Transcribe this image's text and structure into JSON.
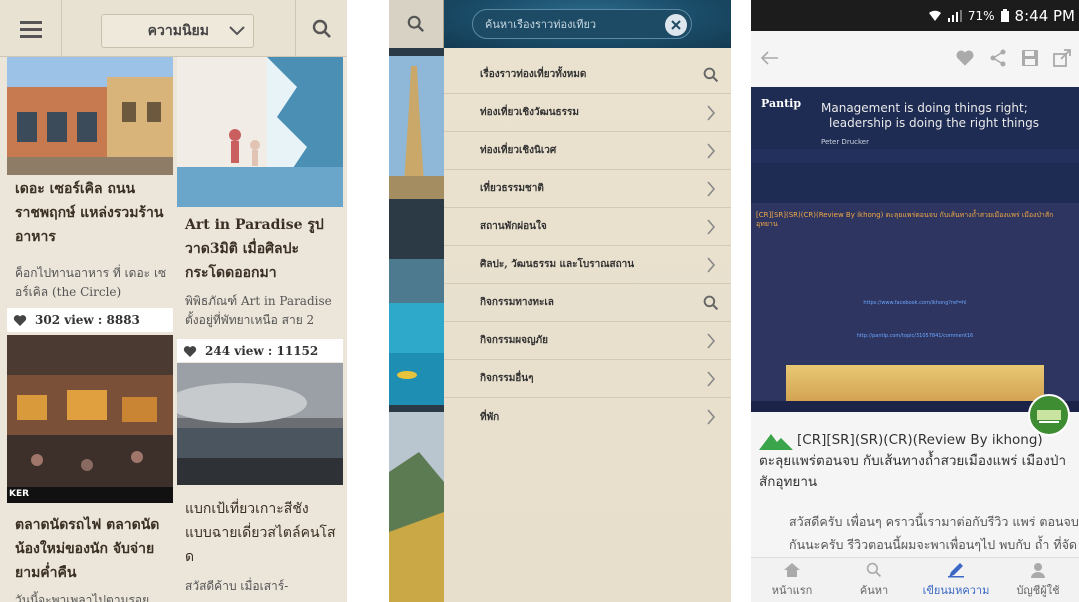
{
  "screen1": {
    "sort_label": "ความนิยม",
    "cards": [
      {
        "title": "เดอะ เซอร์เคิล ถนนราชพฤกษ์ แหล่งรวมร้านอาหาร",
        "desc": "ค็อกไปทานอาหาร ที่ เดอะ เซอร์เคิล (the Circle)",
        "stats": "302 view : 8883"
      },
      {
        "title": "Art in Paradise รูปวาด3มิติ เมื่อศิลปะกระโดดออกมา",
        "desc": "พิพิธภัณฑ์ Art in Paradise ตั้งอยู่ที่พัทยาเหนือ สาย 2",
        "stats": "244 view : 11152"
      },
      {
        "title": "ตลาดนัดรถไฟ ตลาดนัดน้องใหม่ของนัก จับจ่ายยามค่ำคืน",
        "desc": "วันนี้จะพาเพลาไปตามรอยทาง"
      },
      {
        "title": "แบกเป้เที่ยวเกาะสีชัง แบบฉายเดี่ยวสไตล์คนโส ด",
        "desc": "สวัสดีค้าบ เมื่อเสาร์-"
      }
    ],
    "card3_overlay": "KER"
  },
  "screen2": {
    "search_placeholder": "ค้นหาเรื่องราวท่องเที่ยว",
    "menu": [
      {
        "label": "เรื่องราวท่องเที่ยวทั้งหมด",
        "icon": "search-icon"
      },
      {
        "label": "ท่องเที่ยวเชิงวัฒนธรรม",
        "icon": "chevron-right-icon"
      },
      {
        "label": "ท่องเที่ยวเชิงนิเวศ",
        "icon": "chevron-right-icon"
      },
      {
        "label": "เที่ยวธรรมชาติ",
        "icon": "chevron-right-icon"
      },
      {
        "label": "สถานพักผ่อนใจ",
        "icon": "chevron-right-icon"
      },
      {
        "label": "ศิลปะ, วัฒนธรรม และโบราณสถาน",
        "icon": "chevron-right-icon"
      },
      {
        "label": "กิจกรรมทางทะเล",
        "icon": "search-icon"
      },
      {
        "label": "กิจกรรมผจญภัย",
        "icon": "chevron-right-icon"
      },
      {
        "label": "กิจกรรมอื่นๆ",
        "icon": "chevron-right-icon"
      },
      {
        "label": "ที่พัก",
        "icon": "chevron-right-icon"
      }
    ]
  },
  "screen3": {
    "status": {
      "battery": "71%",
      "time": "8:44 PM"
    },
    "preview": {
      "logo": "Pantip",
      "quote_line1": "Management is doing things right;",
      "quote_line2": "leadership is doing the right things",
      "quote_author": "Peter Drucker",
      "post_title_small": "[CR][SR](SR)(CR)(Review By ikhong) ตะลุยแพร่ตอนจบ กับเส้นทางถ้ำสวยเมืองแพร่ เมืองป่าสักอุทยาน",
      "link1": "https://www.facebook.com/ikhong?ref=hl",
      "link2": "http://pantip.com/topic/31057841/comment16"
    },
    "post_title": "[CR][SR](SR)(CR)(Review By ikhong) ตะลุยแพร่ตอนจบ กับเส้นทางถ้ำสวยเมืองแพร่ เมืองป่าสักอุทยาน",
    "post_excerpt_1": "สวัสดีครับ เพื่อนๆ คราวนี้เรามาต่อกับรีวิว แพร่ ตอนจบ",
    "post_excerpt_2": "กันนะครับ รีวิวตอนนี้ผมจะพาเพื่อนๆไป พบกับ ถ้ำ ที่จัด",
    "nav": [
      {
        "label": "หน้าแรก",
        "icon": "home-icon"
      },
      {
        "label": "ค้นหา",
        "icon": "search-icon"
      },
      {
        "label": "เขียนมหความ",
        "icon": "pen-icon"
      },
      {
        "label": "บัญชีผู้ใช้",
        "icon": "user-icon"
      }
    ]
  },
  "colors": {
    "cream_bg": "#ece6da",
    "drawer_blue": "#1a4c68",
    "pantip_navy": "#1e2b52",
    "active_blue": "#3a68c4"
  }
}
